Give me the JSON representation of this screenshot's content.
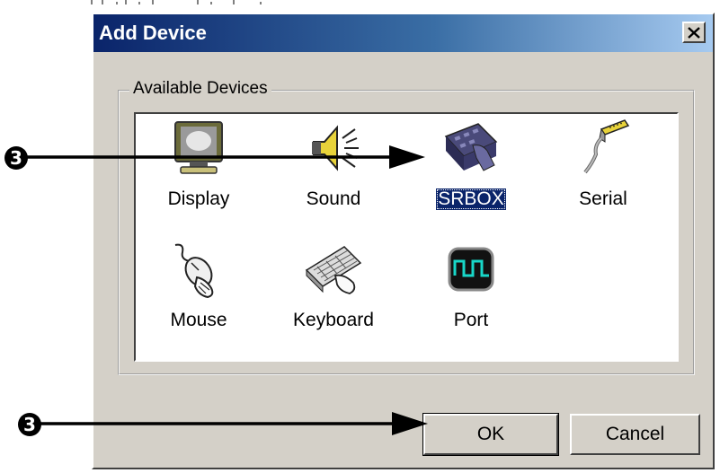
{
  "dialog": {
    "title": "Add Device",
    "close_icon": "close-x-icon",
    "group_label": "Available Devices",
    "devices": [
      {
        "label": "Display",
        "icon": "monitor-icon",
        "selected": false
      },
      {
        "label": "Sound",
        "icon": "speaker-icon",
        "selected": false
      },
      {
        "label": "SRBOX",
        "icon": "srbox-icon",
        "selected": true
      },
      {
        "label": "Serial",
        "icon": "serial-cable-icon",
        "selected": false
      },
      {
        "label": "Mouse",
        "icon": "mouse-icon",
        "selected": false
      },
      {
        "label": "Keyboard",
        "icon": "keyboard-icon",
        "selected": false
      },
      {
        "label": "Port",
        "icon": "port-icon",
        "selected": false
      }
    ],
    "ok_label": "OK",
    "cancel_label": "Cancel"
  },
  "callouts": [
    {
      "marker": "3",
      "target": "SRBOX"
    },
    {
      "marker": "3",
      "target": "OK"
    }
  ],
  "colors": {
    "title_start": "#0a246a",
    "title_end": "#a6caf0",
    "face": "#d4d0c8",
    "selection": "#0a246a"
  }
}
